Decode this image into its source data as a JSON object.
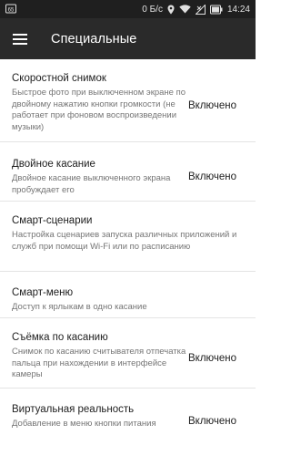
{
  "status_bar": {
    "left_icon": "battery-percent-icon",
    "battery_text": "65",
    "network_speed": "0 Б/с",
    "icons": [
      "location-icon",
      "wifi-icon",
      "signal-off-icon",
      "battery-icon"
    ],
    "time": "14:24"
  },
  "app_bar": {
    "menu_icon": "hamburger-menu-icon",
    "title": "Специальные"
  },
  "settings": [
    {
      "title": "Скоростной снимок",
      "summary": "Быстрое фото при выключенном экране по двойному нажатию кнопки громкости (не работает при фоновом воспроизведении музыки)",
      "value": "Включено"
    },
    {
      "title": "Двойное касание",
      "summary": "Двойное касание выключенного экрана пробуждает его",
      "value": "Включено"
    },
    {
      "title": "Смарт-сценарии",
      "summary": "Настройка сценариев запуска различных приложений и служб при помощи Wi-Fi или по расписанию",
      "value": ""
    },
    {
      "title": "Смарт-меню",
      "summary": "Доступ к ярлыкам в одно касание",
      "value": ""
    },
    {
      "title": "Съёмка по касанию",
      "summary": "Снимок по касанию считывателя отпечатка пальца при нахождении в интерфейсе камеры",
      "value": "Включено"
    },
    {
      "title": "Виртуальная реальность",
      "summary": "Добавление в меню кнопки питания",
      "value": "Включено"
    }
  ]
}
